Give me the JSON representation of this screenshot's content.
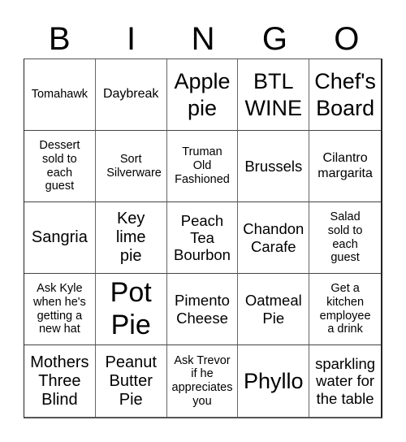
{
  "header": {
    "letters": [
      "B",
      "I",
      "N",
      "G",
      "O"
    ]
  },
  "board": {
    "cells": [
      "Tomahawk",
      "Daybreak",
      "Apple pie",
      "BTL WINE",
      "Chef's Board",
      "Dessert sold to each guest",
      "Sort Silverware",
      "Truman Old Fashioned",
      "Brussels",
      "Cilantro margarita",
      "Sangria",
      "Key lime pie",
      "Peach Tea Bourbon",
      "Chandon Carafe",
      "Salad sold to each guest",
      "Ask Kyle when he's getting a new hat",
      "Pot Pie",
      "Pimento Cheese",
      "Oatmeal Pie",
      "Get a kitchen employee a drink",
      "Mothers Three Blind",
      "Peanut Butter Pie",
      "Ask Trevor if he appreciates you",
      "Phyllo",
      "sparkling water for the table"
    ]
  }
}
